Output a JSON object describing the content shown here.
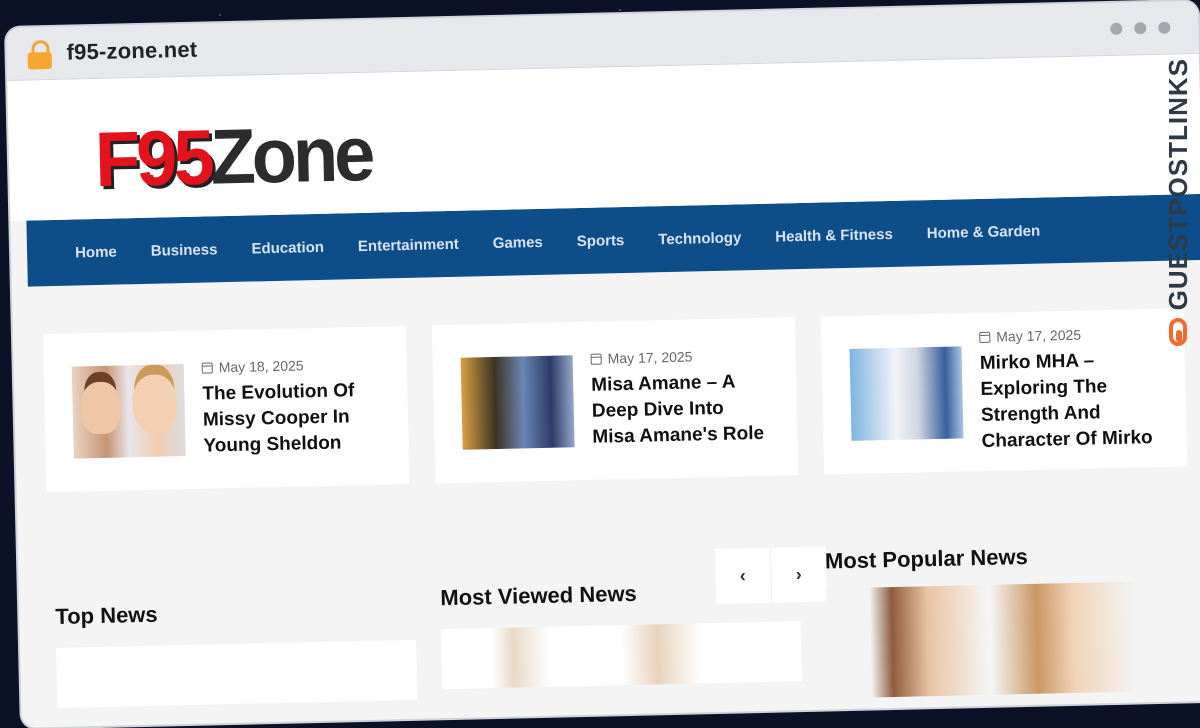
{
  "browser": {
    "url": "f95-zone.net"
  },
  "logo": {
    "part1": "F95",
    "part2": "Zone"
  },
  "nav": {
    "items": [
      "Home",
      "Business",
      "Education",
      "Entertainment",
      "Games",
      "Sports",
      "Technology",
      "Health & Fitness",
      "Home & Garden"
    ]
  },
  "featured": [
    {
      "date": "May 18, 2025",
      "title": "The Evolution Of Missy Cooper In Young Sheldon"
    },
    {
      "date": "May 17, 2025",
      "title": "Misa Amane – A Deep Dive Into Misa Amane's Role"
    },
    {
      "date": "May 17, 2025",
      "title": "Mirko MHA – Exploring The Strength And Character Of Mirko"
    }
  ],
  "sections": {
    "top_news": "Top News",
    "most_viewed": "Most Viewed News",
    "most_popular": "Most Popular News",
    "prev_icon": "‹",
    "next_icon": "›"
  },
  "watermark": {
    "text": "GUESTPOSTLINKS"
  },
  "colors": {
    "nav_bg": "#0d4d8a",
    "logo_red": "#e2131d",
    "watermark_orange": "#f26b2d"
  }
}
